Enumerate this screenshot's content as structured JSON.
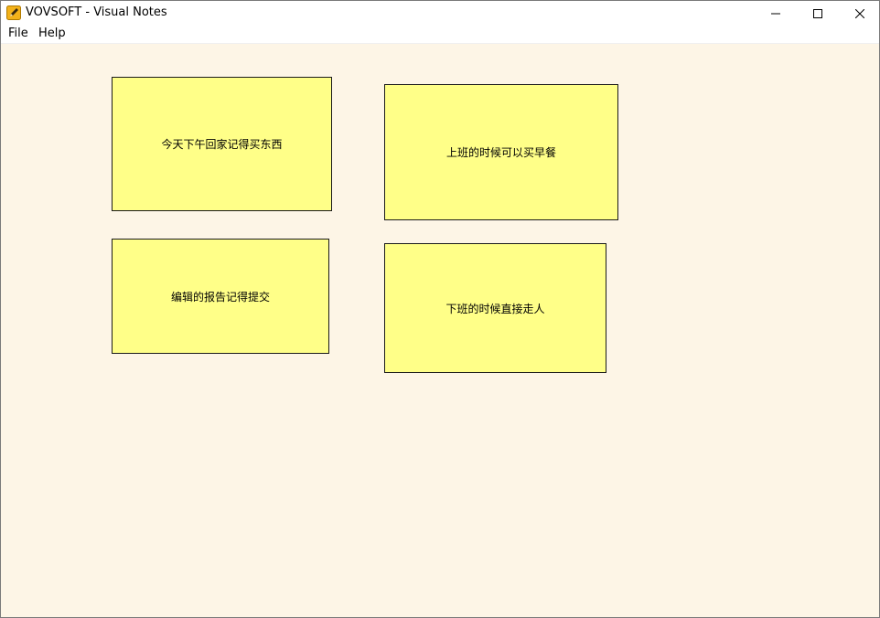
{
  "window": {
    "title": "VOVSOFT - Visual Notes",
    "icon": "pencil-notepad-icon",
    "controls": {
      "minimize": "minimize-icon",
      "maximize": "maximize-icon",
      "close": "close-icon"
    }
  },
  "menu": {
    "items": [
      {
        "label": "File"
      },
      {
        "label": "Help"
      }
    ]
  },
  "canvas": {
    "background": "#fdf5e6"
  },
  "notes": [
    {
      "text": "今天下午回家记得买东西",
      "color": "#ffff88"
    },
    {
      "text": "上班的时候可以买早餐",
      "color": "#ffff88"
    },
    {
      "text": "编辑的报告记得提交",
      "color": "#ffff88"
    },
    {
      "text": "下班的时候直接走人",
      "color": "#ffff88"
    }
  ]
}
